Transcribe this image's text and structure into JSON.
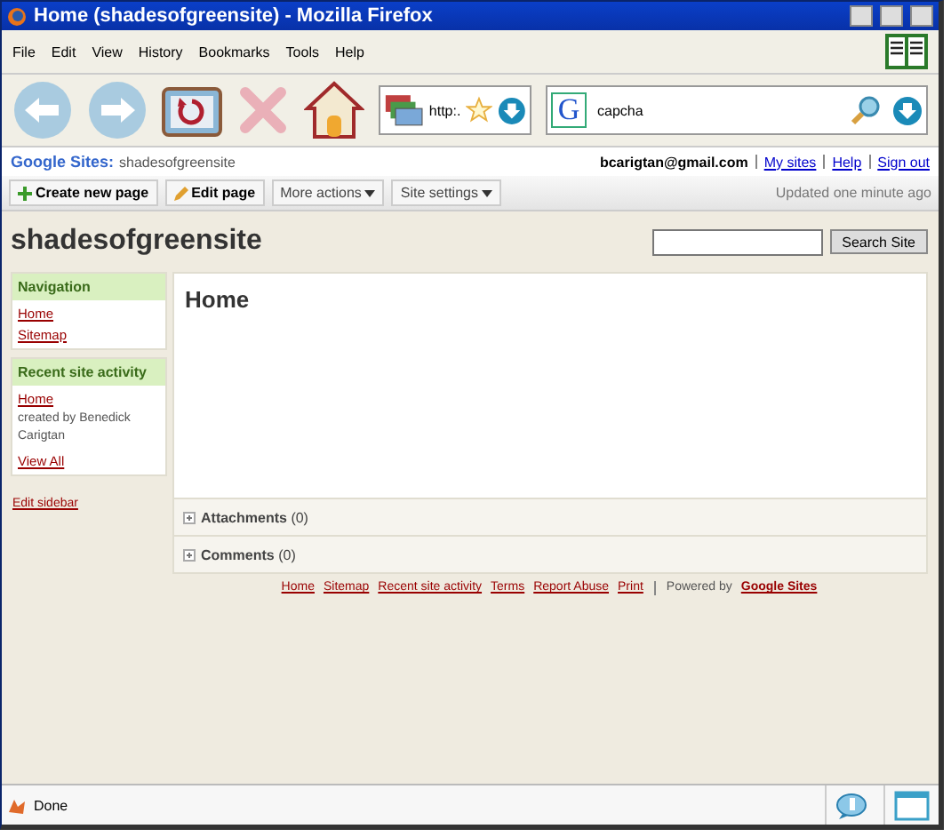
{
  "window": {
    "title": "Home (shadesofgreensite) - Mozilla Firefox"
  },
  "menu": [
    "File",
    "Edit",
    "View",
    "History",
    "Bookmarks",
    "Tools",
    "Help"
  ],
  "toolbar": {
    "url": "http:.",
    "search_engine": "G",
    "search": "capcha"
  },
  "sites_bar": {
    "brand": "Google Sites:",
    "site": "shadesofgreensite",
    "user": "bcarigtan@gmail.com",
    "links": [
      "My sites",
      "Help",
      "Sign out"
    ]
  },
  "actions": [
    {
      "label": "Create new page",
      "kind": "add"
    },
    {
      "label": "Edit page",
      "kind": "edit"
    },
    {
      "label": "More actions",
      "kind": "menu"
    },
    {
      "label": "Site settings",
      "kind": "menu"
    }
  ],
  "updated": "Updated one minute ago",
  "site_title": "shadesofgreensite",
  "search_button": "Search Site",
  "sidebar": {
    "navigation": {
      "title": "Navigation",
      "items": [
        "Home",
        "Sitemap"
      ]
    },
    "activity": {
      "title": "Recent site activity",
      "link": "Home",
      "note": "created by Benedick Carigtan",
      "view_all": "View All"
    },
    "edit": "Edit sidebar"
  },
  "page": {
    "title": "Home",
    "sections": [
      {
        "label": "Attachments",
        "count": "(0)",
        "expanded": false
      },
      {
        "label": "Comments",
        "count": "(0)",
        "expanded": false
      }
    ]
  },
  "footer": {
    "links": [
      "Home",
      "Sitemap",
      "Recent site activity",
      "Terms",
      "Report Abuse",
      "Print"
    ],
    "powered": "Powered by",
    "powered_link": "Google Sites"
  },
  "status": "Done"
}
